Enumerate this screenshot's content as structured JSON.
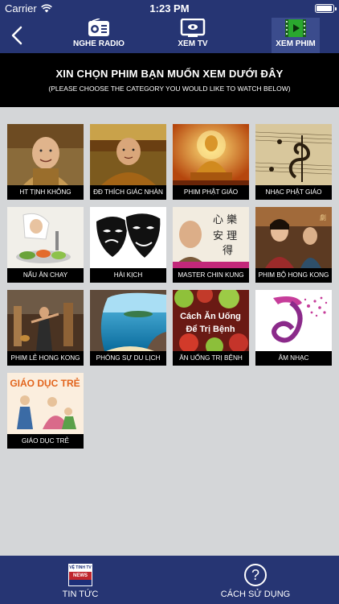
{
  "status_bar": {
    "carrier": "Carrier",
    "time": "1:23 PM"
  },
  "nav": {
    "tabs": [
      {
        "label": "NGHE RADIO",
        "icon": "radio-icon"
      },
      {
        "label": "XEM TV",
        "icon": "tv-icon"
      },
      {
        "label": "XEM PHIM",
        "icon": "film-icon",
        "active": true
      }
    ]
  },
  "banner": {
    "title": "XIN CHỌN PHIM BẠN MUỐN XEM DƯỚI ĐÂY",
    "subtitle": "(PLEASE CHOOSE THE CATEGORY YOU WOULD LIKE TO WATCH BELOW)"
  },
  "categories": [
    {
      "label": "HT TỊNH KHÔNG",
      "overlay": ""
    },
    {
      "label": "ĐĐ THÍCH GIÁC NHÀN",
      "overlay": ""
    },
    {
      "label": "PHIM PHẬT GIÁO",
      "overlay": ""
    },
    {
      "label": "NHẠC PHẬT GIÁO",
      "overlay": ""
    },
    {
      "label": "NẤU ĂN CHAY",
      "overlay": ""
    },
    {
      "label": "HÀI KỊCH",
      "overlay": ""
    },
    {
      "label": "MASTER CHIN KUNG",
      "overlay": ""
    },
    {
      "label": "PHIM BỘ HONG KONG",
      "overlay": ""
    },
    {
      "label": "PHIM LẺ HONG KONG",
      "overlay": ""
    },
    {
      "label": "PHÓNG SỰ DU LỊCH",
      "overlay": ""
    },
    {
      "label": "ĂN UỐNG TRỊ BỆNH",
      "overlay": "Cách Ăn Uống Để Trị Bệnh"
    },
    {
      "label": "ÂM NHẠC",
      "overlay": ""
    },
    {
      "label": "GIÁO DỤC TRẺ",
      "overlay": "GIÁO DỤC TRẺ"
    }
  ],
  "bottom_bar": {
    "news": {
      "label": "TIN TỨC",
      "logo_top": "VỆ TINH TV",
      "logo_mid": "NEWS"
    },
    "help": {
      "label": "CÁCH SỬ DỤNG",
      "glyph": "?"
    }
  },
  "colors": {
    "nav_bg": "#263573",
    "active_tab": "#3b4c8d",
    "banner_bg": "#000000",
    "page_bg": "#d4d6d8"
  }
}
